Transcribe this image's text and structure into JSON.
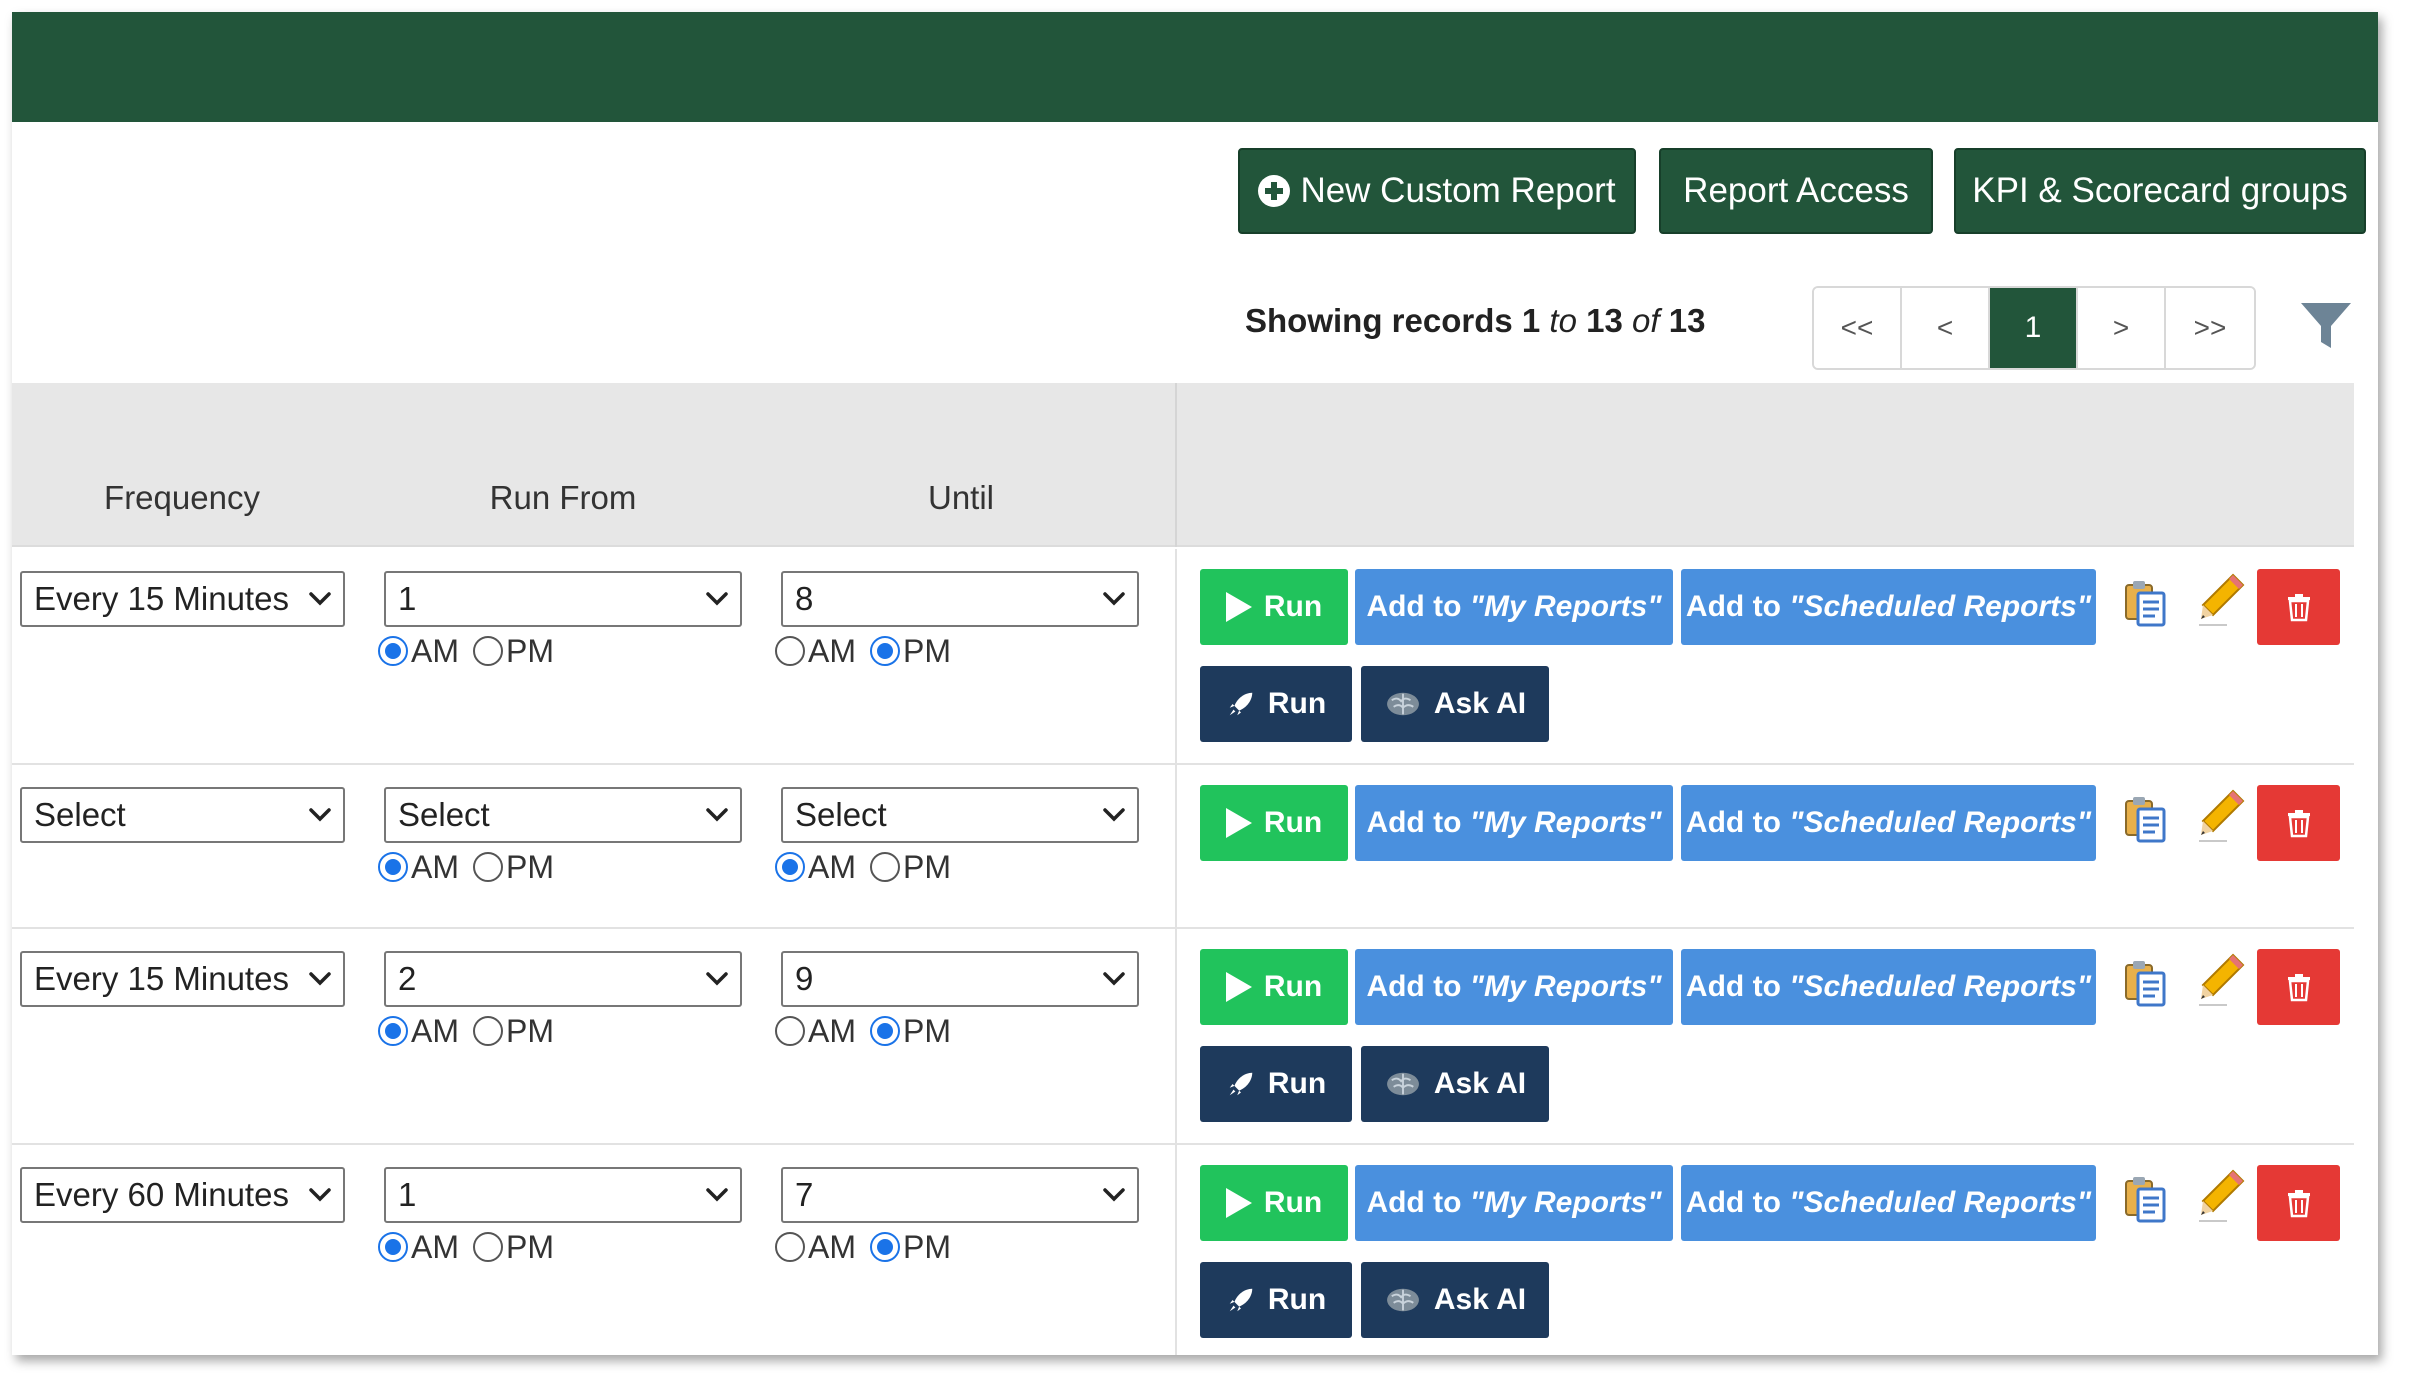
{
  "toolbar": {
    "new_report_label": "New Custom Report",
    "report_access_label": "Report Access",
    "kpi_label": "KPI & Scorecard groups"
  },
  "records": {
    "prefix": "Showing records",
    "from": "1",
    "to_word": "to",
    "to": "13",
    "of_word": "of",
    "total": "13"
  },
  "pagination": {
    "first": "<<",
    "prev": "<",
    "current": "1",
    "next": ">",
    "last": ">>"
  },
  "table": {
    "headers": {
      "frequency": "Frequency",
      "run_from": "Run From",
      "until": "Until"
    },
    "rows": [
      {
        "frequency": "Every 15 Minutes",
        "run_from": "1",
        "run_from_period": "AM",
        "until": "8",
        "until_period": "PM"
      },
      {
        "frequency": "Select",
        "run_from": "Select",
        "run_from_period": "AM",
        "until": "Select",
        "until_period": "AM"
      },
      {
        "frequency": "Every 15 Minutes",
        "run_from": "2",
        "run_from_period": "AM",
        "until": "9",
        "until_period": "PM"
      },
      {
        "frequency": "Every 60 Minutes",
        "run_from": "1",
        "run_from_period": "AM",
        "until": "7",
        "until_period": "PM"
      }
    ]
  },
  "labels": {
    "am": "AM",
    "pm": "PM",
    "run": "Run",
    "add_my_prefix": "Add to ",
    "add_my_quoted": "\"My Reports\"",
    "add_sched_prefix": "Add to ",
    "add_sched_quoted": "\"Scheduled Reports\"",
    "ask_ai": "Ask AI"
  },
  "icons": {
    "new_report": "plus-circle-icon",
    "filter": "filter-icon",
    "run": "play-icon",
    "run_alt": "rocket-icon",
    "ask_ai": "brain-icon",
    "copy": "clipboard-copy-icon",
    "edit": "pencil-icon",
    "delete": "trash-icon"
  },
  "colors": {
    "brand_green": "#22553a",
    "run_green": "#21c35c",
    "action_blue": "#4a90de",
    "dark_navy": "#1e3a5c",
    "delete_red": "#e53935",
    "radio_blue": "#1a73e8"
  }
}
